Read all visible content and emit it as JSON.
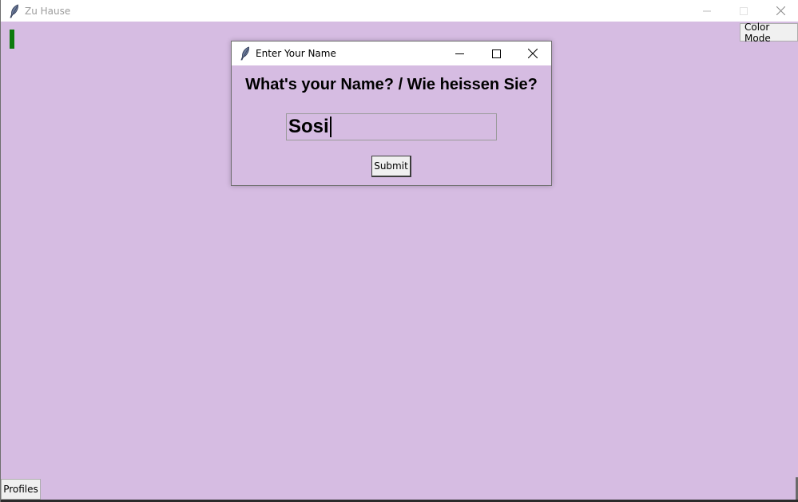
{
  "main_window": {
    "title": "Zu Hause",
    "background_color": "#d6bce2",
    "title_icon": "feather-icon",
    "color_mode_label": "Color Mode",
    "profiles_label": "Profiles",
    "indicator_color": "#0d7a0d"
  },
  "dialog": {
    "title": "Enter Your Name",
    "title_icon": "feather-icon",
    "prompt": "What's your Name? / Wie heissen Sie?",
    "name_value": "Sosi",
    "submit_label": "Submit"
  }
}
